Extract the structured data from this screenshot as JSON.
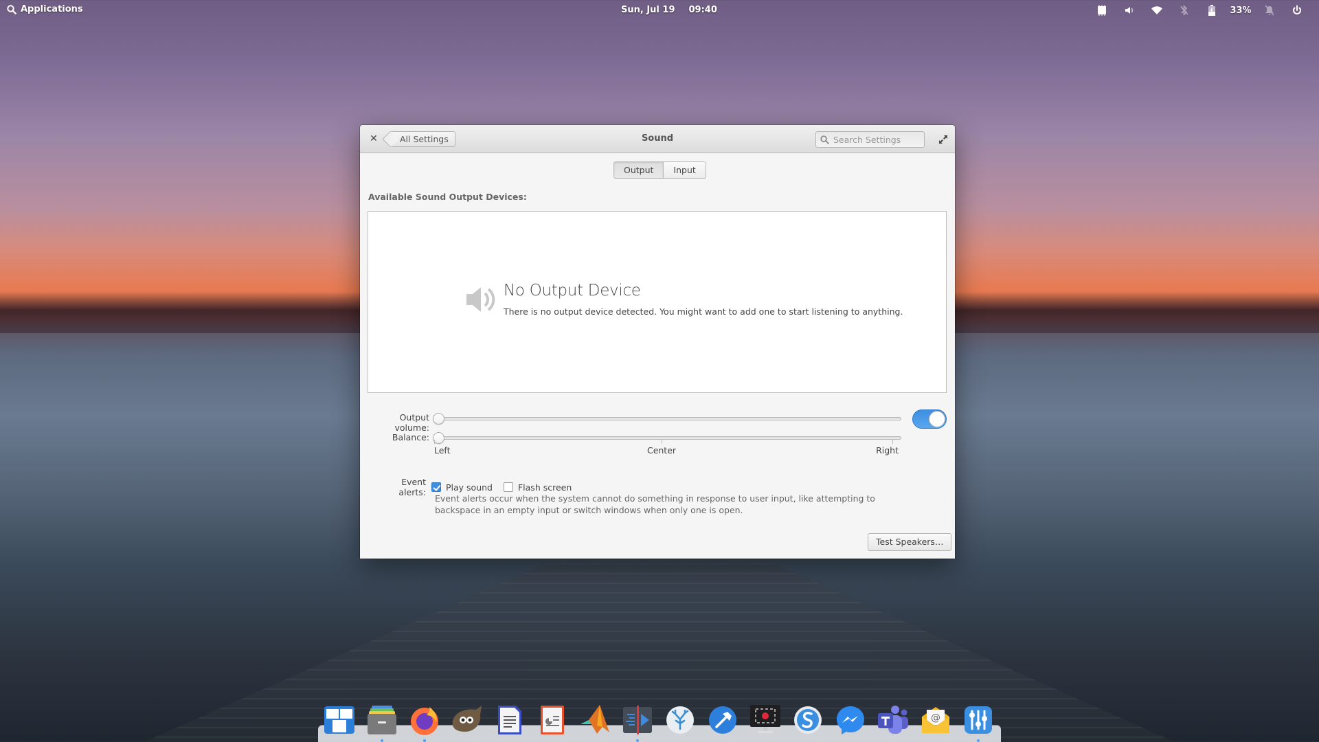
{
  "panel": {
    "applications_label": "Applications",
    "date": "Sun, Jul 19",
    "time": "09:40",
    "battery_percent": "33%",
    "indicators": [
      "cpu-monitor-icon",
      "volume-icon",
      "wifi-icon",
      "bluetooth-disabled-icon",
      "battery-icon",
      "notifications-disabled-icon",
      "power-icon"
    ]
  },
  "window": {
    "title": "Sound",
    "back_label": "All Settings",
    "search_placeholder": "Search Settings",
    "tabs": [
      {
        "label": "Output",
        "active": true
      },
      {
        "label": "Input",
        "active": false
      }
    ],
    "section_label": "Available Sound Output Devices:",
    "empty_state": {
      "title": "No Output Device",
      "description": "There is no output device detected. You might want to add one to start listening to anything."
    },
    "output_volume": {
      "label": "Output volume:",
      "value_percent": 0,
      "enabled": true
    },
    "balance": {
      "label": "Balance:",
      "value": "Left",
      "marks": [
        "Left",
        "Center",
        "Right"
      ]
    },
    "event_alerts": {
      "label": "Event alerts:",
      "play_sound": {
        "label": "Play sound",
        "checked": true
      },
      "flash_screen": {
        "label": "Flash screen",
        "checked": false
      },
      "description": "Event alerts occur when the system cannot do something in response to user input, like attempting to backspace in an empty input or switch windows when only one is open."
    },
    "test_button_label": "Test Speakers…"
  },
  "dock": {
    "items": [
      {
        "name": "multitasking-view",
        "running": false
      },
      {
        "name": "files",
        "running": true
      },
      {
        "name": "firefox",
        "running": true
      },
      {
        "name": "gimp",
        "running": false
      },
      {
        "name": "libreoffice-writer",
        "running": false
      },
      {
        "name": "libreoffice-impress",
        "running": false
      },
      {
        "name": "matlab",
        "running": false
      },
      {
        "name": "code-editor",
        "running": true
      },
      {
        "name": "vscodium",
        "running": false
      },
      {
        "name": "build-tool",
        "running": false
      },
      {
        "name": "screen-recorder",
        "running": false
      },
      {
        "name": "simplenote",
        "running": false
      },
      {
        "name": "messenger",
        "running": false
      },
      {
        "name": "teams",
        "running": false
      },
      {
        "name": "mail",
        "running": false
      },
      {
        "name": "system-settings",
        "running": true
      }
    ]
  },
  "colors": {
    "accent": "#3f8ee0",
    "window_bg": "#f5f5f5",
    "dock_indicator": "#4aa0ff"
  }
}
